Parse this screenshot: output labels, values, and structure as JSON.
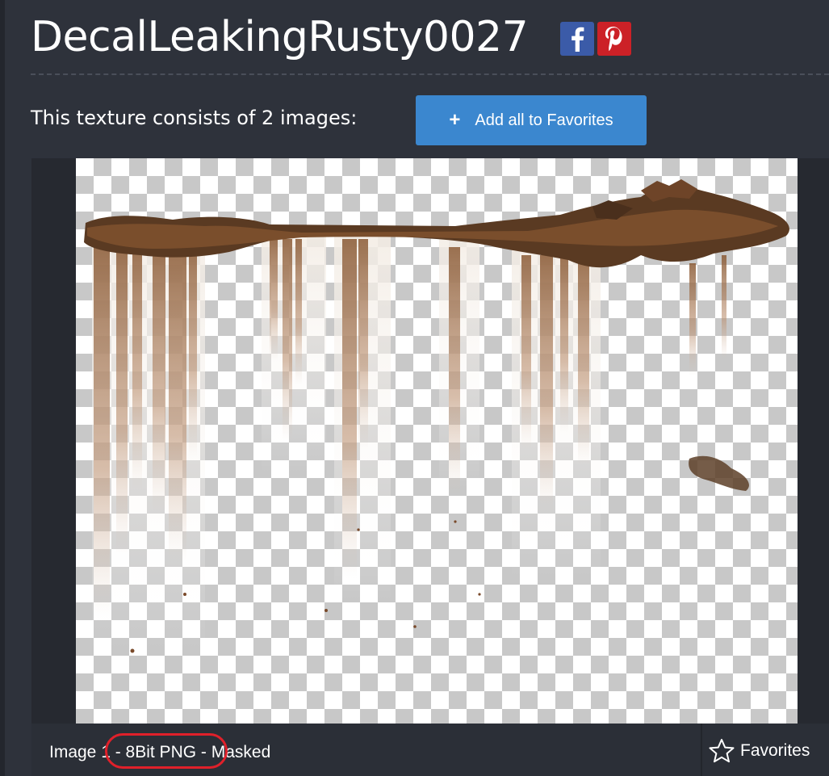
{
  "header": {
    "title": "DecalLeakingRusty0027",
    "social": [
      {
        "icon": "facebook-icon",
        "glyph": "f",
        "color": "#3b5ba8"
      },
      {
        "icon": "pinterest-icon",
        "glyph": "p",
        "color": "#cc2127"
      }
    ]
  },
  "info": {
    "text": "This texture consists of 2 images:",
    "add_all_label": "Add all to Favorites",
    "add_all_icon": "plus-icon",
    "accent_color": "#3b87cf"
  },
  "image_viewer": {
    "preview_icon": "texture-preview-image",
    "caption": "Image 1 - 8Bit PNG - Masked",
    "highlight_color": "#e0202a",
    "favorites_label": "Favorites",
    "favorites_icon": "star-outline-icon"
  }
}
